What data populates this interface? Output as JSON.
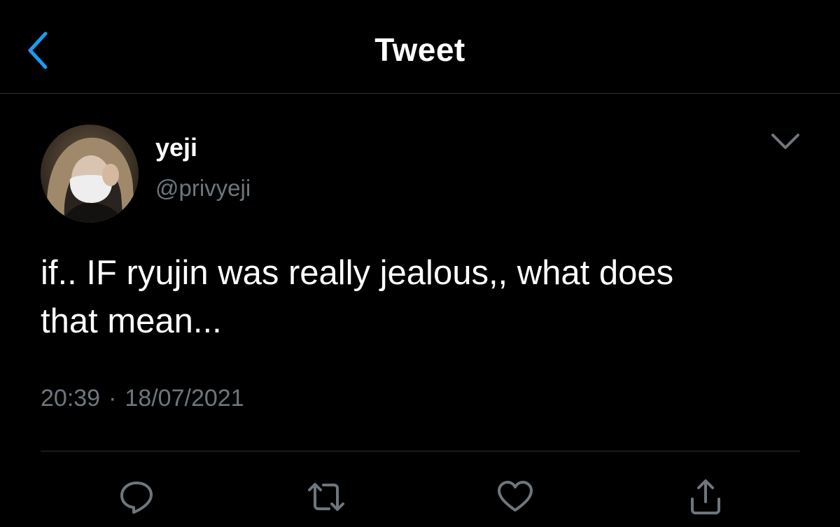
{
  "header": {
    "title": "Tweet",
    "back_icon": "chevron-left-icon"
  },
  "author": {
    "name": "yeji",
    "handle": "@privyeji",
    "menu_icon": "chevron-down-icon"
  },
  "tweet": {
    "line1": "if.. IF ryujin was really jealous,, what does",
    "line2": "that mean...",
    "time": "20:39",
    "separator": "·",
    "date": "18/07/2021"
  },
  "actions": [
    {
      "icon": "reply-icon"
    },
    {
      "icon": "retweet-icon"
    },
    {
      "icon": "like-icon"
    },
    {
      "icon": "share-icon"
    }
  ],
  "colors": {
    "background": "#000000",
    "text": "#ffffff",
    "secondary_text": "#6e767d",
    "accent": "#1d9bf0",
    "divider": "#2f3336"
  }
}
